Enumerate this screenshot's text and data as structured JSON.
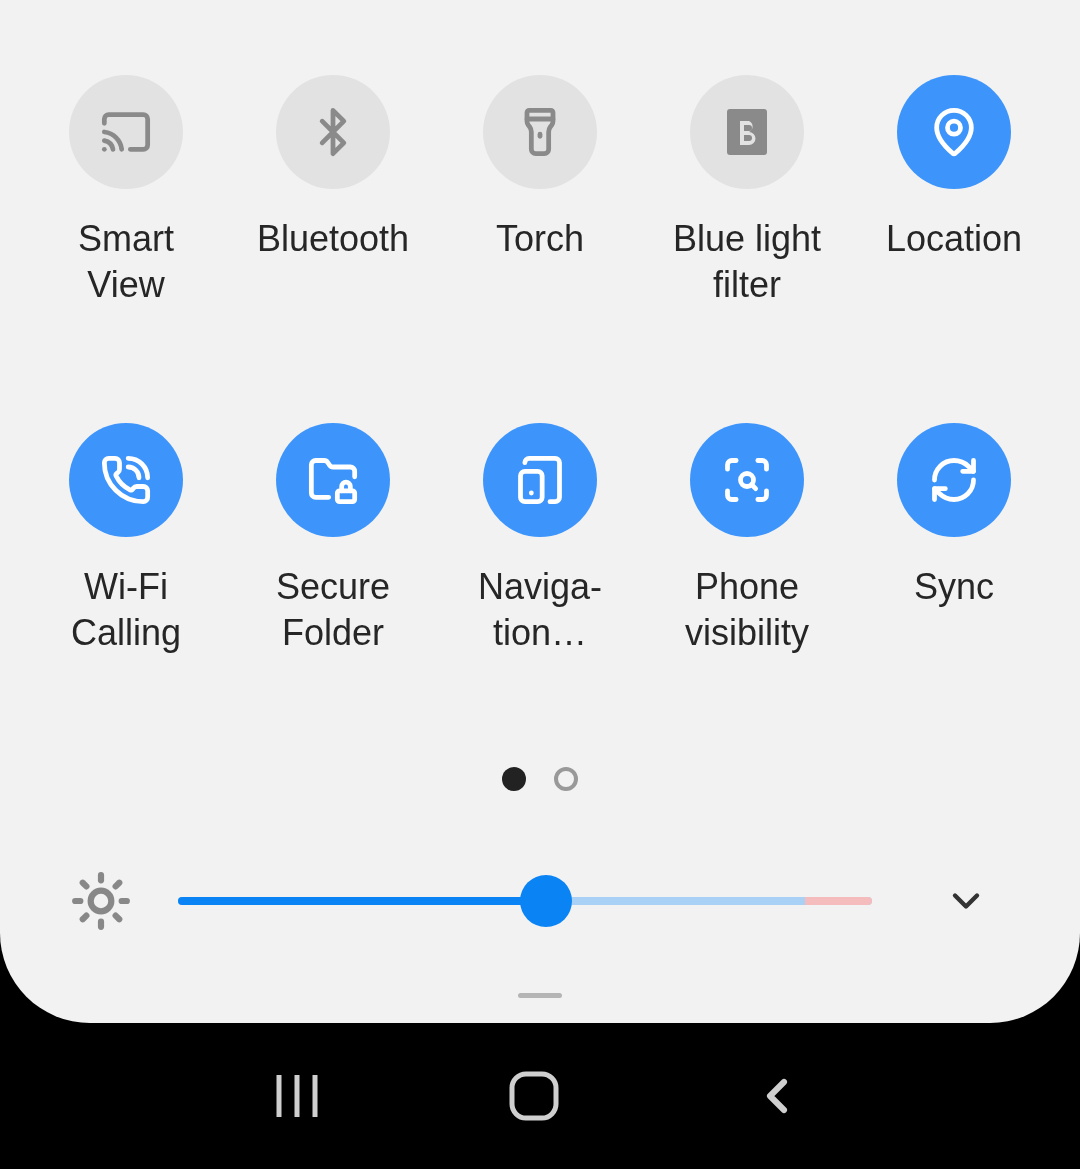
{
  "tiles": [
    {
      "label": "Smart\nView",
      "on": false
    },
    {
      "label": "Bluetooth",
      "on": false
    },
    {
      "label": "Torch",
      "on": false
    },
    {
      "label": "Blue light\nfilter",
      "on": false
    },
    {
      "label": "Location",
      "on": true
    },
    {
      "label": "Wi-Fi\nCalling",
      "on": true
    },
    {
      "label": "Secure\nFolder",
      "on": true
    },
    {
      "label": "Naviga-\ntion…",
      "on": true
    },
    {
      "label": "Phone\nvisibility",
      "on": true
    },
    {
      "label": "Sync",
      "on": true
    }
  ],
  "pages": [
    {
      "selected": true
    },
    {
      "selected": false
    }
  ],
  "brightness": {
    "level": 0.53
  }
}
